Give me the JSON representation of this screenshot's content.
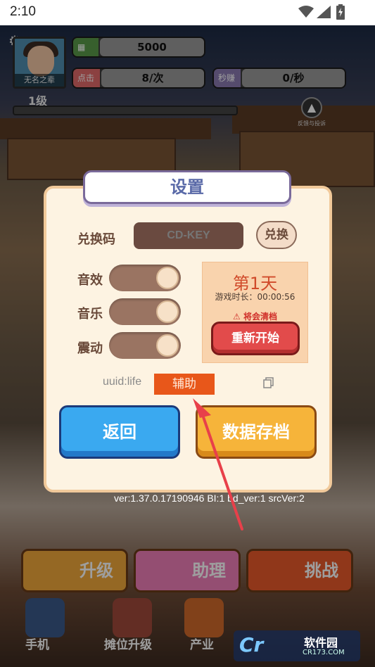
{
  "status_bar": {
    "time": "2:10"
  },
  "hud": {
    "player_name": "无名之辈",
    "money": "5000",
    "click_label": "点击",
    "click_value": "8/次",
    "earn_label": "秒赚",
    "earn_value": "0/秒",
    "level": "1级",
    "feedback": "反馈与投诉"
  },
  "dialog": {
    "title": "设置",
    "redeem_label": "兑换码",
    "redeem_placeholder": "CD-KEY",
    "redeem_button": "兑换",
    "sound_label": "音效",
    "music_label": "音乐",
    "vibration_label": "震动",
    "day_text": "第1天",
    "play_time": "游戏时长：00:00:56",
    "warning": "将会清档",
    "restart_button": "重新开始",
    "uuid_text": "uuid:life",
    "assist_label": "辅助",
    "back_button": "返回",
    "save_button": "数据存档"
  },
  "version_text": "ver:1.37.0.17190946 BI:1 bd_ver:1 srcVer:2",
  "game_buttons": {
    "upgrade": "升级",
    "assistant": "助理",
    "challenge": "挑战"
  },
  "bottom_nav": {
    "phone": "手机",
    "stall_upgrade": "摊位升级",
    "industry": "产业"
  },
  "watermark": {
    "site": "软件园",
    "domain": "CR173.COM",
    "logo": "Cr"
  },
  "colors": {
    "accent_red": "#e24b4b",
    "accent_blue": "#3aa9f0",
    "accent_orange": "#f6b43a",
    "dialog_bg": "#fdf3e2",
    "title_blue": "#5a6aa8"
  }
}
